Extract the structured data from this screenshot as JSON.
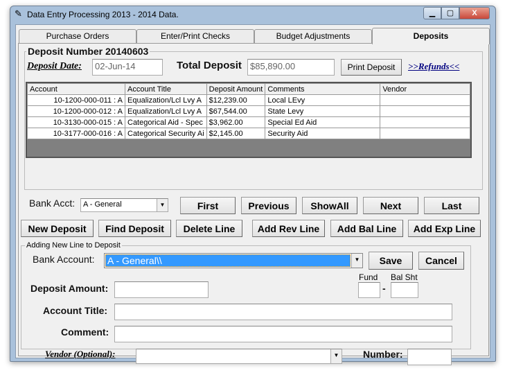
{
  "window": {
    "title": "Data Entry  Processing 2013 - 2014 Data.",
    "icon": "clipboard-icon"
  },
  "tabs": [
    {
      "label": "Purchase Orders"
    },
    {
      "label": "Enter/Print Checks"
    },
    {
      "label": "Budget Adjustments"
    },
    {
      "label": "Deposits",
      "active": true
    }
  ],
  "deposit": {
    "group_label": "Deposit Number 20140603",
    "date_label": "Deposit Date:",
    "date_value": "02-Jun-14",
    "total_label": "Total Deposit",
    "total_value": "$85,890.00",
    "print_label": "Print Deposit",
    "refunds_label": ">>Refunds<<"
  },
  "grid": {
    "columns": [
      "Account",
      "Account Title",
      "Deposit Amount",
      "Comments",
      "Vendor"
    ],
    "rows": [
      [
        "10-1200-000-011 : A",
        "Equalization/Lcl Lvy A",
        "$12,239.00",
        "Local LEvy",
        ""
      ],
      [
        "10-1200-000-012 : A",
        "Equalization/Lcl Lvy A",
        "$67,544.00",
        "State Levy",
        ""
      ],
      [
        "10-3130-000-015 : A",
        "Categorical Aid - Spec",
        "$3,962.00",
        "Special Ed Aid",
        ""
      ],
      [
        "10-3177-000-016 : A",
        "Categorical Security Ai",
        "$2,145.00",
        "Security Aid",
        ""
      ]
    ]
  },
  "nav": {
    "bank_acct_label": "Bank Acct:",
    "bank_acct_value": "A - General",
    "first": "First",
    "previous": "Previous",
    "showall": "ShowAll",
    "next": "Next",
    "last": "Last"
  },
  "actions": {
    "new_deposit": "New Deposit",
    "find_deposit": "Find Deposit",
    "delete_line": "Delete Line",
    "add_rev": "Add Rev Line",
    "add_bal": "Add Bal Line",
    "add_exp": "Add Exp Line"
  },
  "new_line": {
    "group_label": "Adding New Line to Deposit",
    "bank_account_label": "Bank Account:",
    "bank_account_value": "A - General\\\\",
    "save": "Save",
    "cancel": "Cancel",
    "deposit_amount_label": "Deposit Amount:",
    "fund_label": "Fund",
    "balsht_label": "Bal Sht",
    "dash": "-",
    "account_title_label": "Account Title:",
    "comment_label": "Comment:",
    "vendor_label": "Vendor (Optional):",
    "number_label": "Number:"
  },
  "colors": {
    "selection": "#3399ff",
    "grid_empty": "#808080"
  }
}
